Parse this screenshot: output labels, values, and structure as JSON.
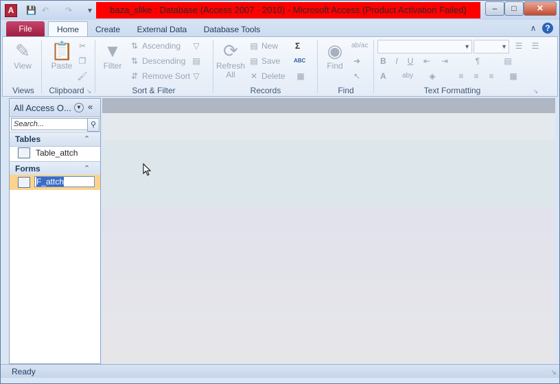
{
  "window": {
    "title": "baza_slike : Database (Access 2007 - 2010)  -  Microsoft Access (Product Activation Failed)",
    "app_icon": "A",
    "title_bg": "#ff0000",
    "minimize": "–",
    "maximize": "□",
    "close": "✕"
  },
  "qat": {
    "save": "💾",
    "undo": "↶",
    "redo": "↷",
    "customize": "▾"
  },
  "tabs": [
    "File",
    "Home",
    "Create",
    "External Data",
    "Database Tools"
  ],
  "ribbon_corner": {
    "minimize": "∧",
    "help": "?"
  },
  "groups": {
    "views": {
      "label": "Views",
      "view": "View"
    },
    "clipboard": {
      "label": "Clipboard",
      "paste": "Paste"
    },
    "sort_filter": {
      "label": "Sort & Filter",
      "filter": "Filter",
      "ascending": "Ascending",
      "descending": "Descending",
      "remove_sort": "Remove Sort"
    },
    "records": {
      "label": "Records",
      "refresh": "Refresh",
      "refresh_all": "All",
      "new": "New",
      "save": "Save",
      "delete": "Delete",
      "totals_icon": "Σ",
      "spelling_icon": "ABC"
    },
    "find": {
      "label": "Find",
      "find": "Find",
      "replace_icon": "ab/ac"
    },
    "text_formatting": {
      "label": "Text Formatting",
      "bold": "B",
      "font_color": "A",
      "highlight": "aby"
    }
  },
  "nav": {
    "title": "All Access O...",
    "search_placeholder": "Search...",
    "categories": [
      {
        "label": "Tables",
        "items": [
          "Table_attch"
        ]
      },
      {
        "label": "Forms",
        "items": [
          "F_attch"
        ]
      }
    ]
  },
  "status": {
    "text": "Ready"
  }
}
